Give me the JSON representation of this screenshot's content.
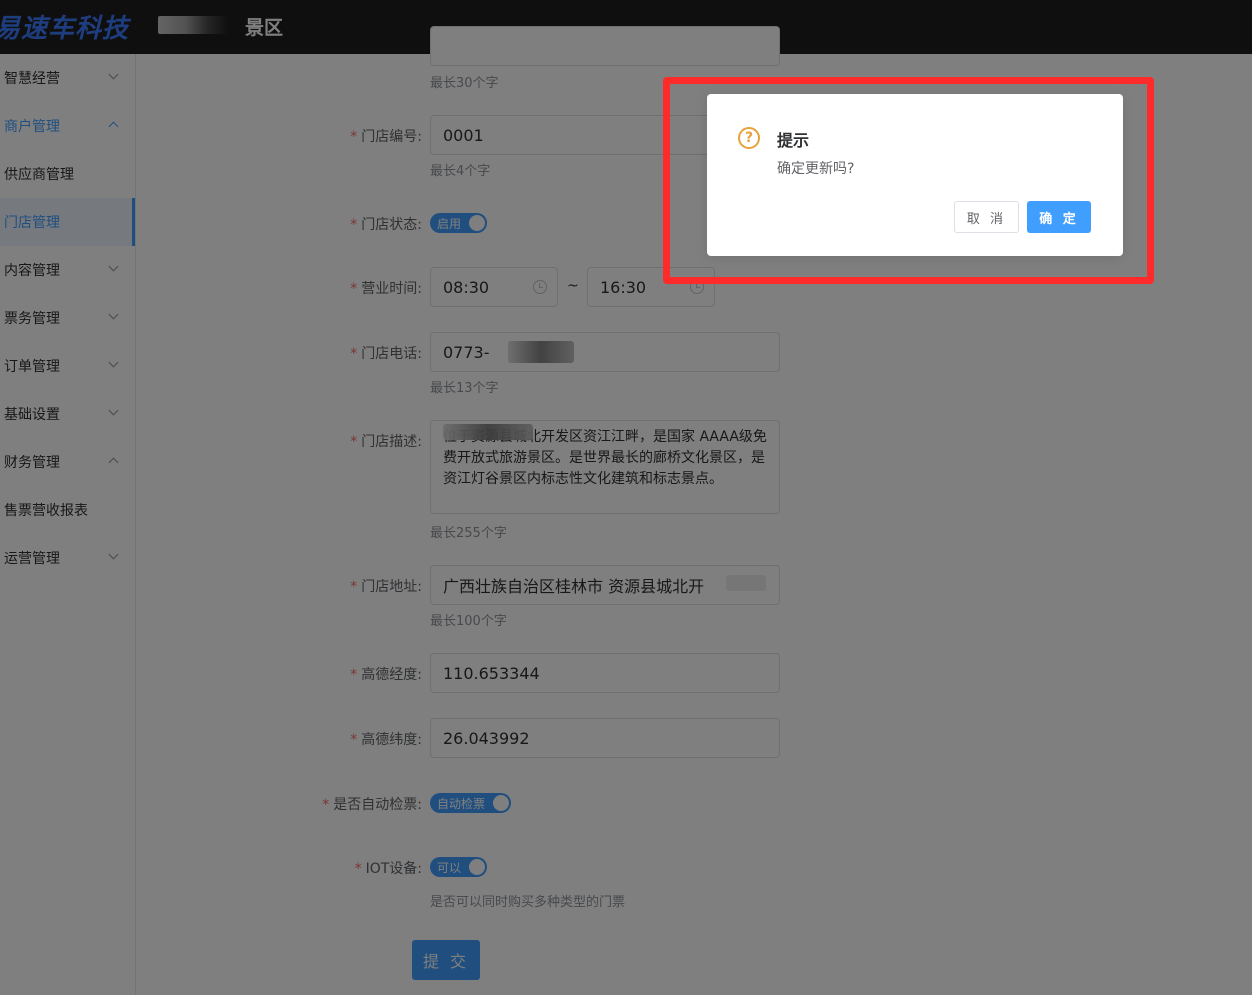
{
  "header": {
    "logo_text": "易速车科技",
    "scenic_suffix": "景区"
  },
  "sidebar": {
    "items": [
      {
        "label": "智慧经营"
      },
      {
        "label": "商户管理"
      },
      {
        "label": "供应商管理"
      },
      {
        "label": "门店管理"
      },
      {
        "label": "内容管理"
      },
      {
        "label": "票务管理"
      },
      {
        "label": "订单管理"
      },
      {
        "label": "基础设置"
      },
      {
        "label": "财务管理"
      },
      {
        "label": "售票营收报表"
      },
      {
        "label": "运营管理"
      }
    ]
  },
  "form": {
    "name_hint": "最长30个字",
    "code": {
      "label": "门店编号:",
      "value": "0001",
      "hint": "最长4个字"
    },
    "status": {
      "label": "门店状态:",
      "switch_text": "启用"
    },
    "hours": {
      "label": "营业时间:",
      "start": "08:30",
      "separator": "~",
      "end": "16:30"
    },
    "phone": {
      "label": "门店电话:",
      "value": "0773-",
      "hint": "最长13个字"
    },
    "desc": {
      "label": "门店描述:",
      "value": "位于资源县城北开发区资江江畔，是国家 AAAA级免费开放式旅游景区。是世界最长的廊桥文化景区，是资江灯谷景区内标志性文化建筑和标志景点。",
      "hint": "最长255个字"
    },
    "address": {
      "label": "门店地址:",
      "value": "广西壮族自治区桂林市 资源县城北开",
      "hint": "最长100个字"
    },
    "lng": {
      "label": "高德经度:",
      "value": "110.653344"
    },
    "lat": {
      "label": "高德纬度:",
      "value": "26.043992"
    },
    "auto_check": {
      "label": "是否自动检票:",
      "switch_text": "自动检票"
    },
    "iot": {
      "label": "IOT设备:",
      "switch_text": "可以",
      "hint": "是否可以同时购买多种类型的门票"
    },
    "submit_label": "提 交",
    "required_mark": "*"
  },
  "dialog": {
    "icon": "question-circle-icon",
    "icon_glyph": "?",
    "title": "提示",
    "message": "确定更新吗?",
    "cancel_label": "取 消",
    "confirm_label": "确 定"
  }
}
